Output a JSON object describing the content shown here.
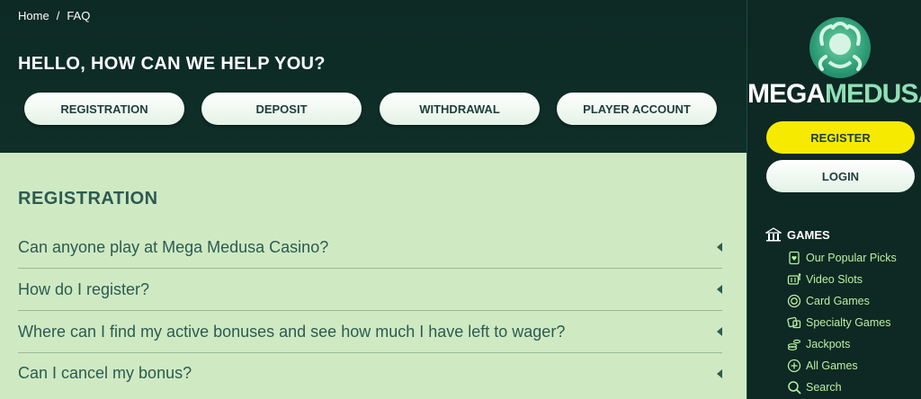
{
  "breadcrumb": {
    "home": "Home",
    "separator": "/",
    "current": "FAQ"
  },
  "hero": {
    "title": "HELLO, HOW CAN WE HELP YOU?",
    "categories": [
      "REGISTRATION",
      "DEPOSIT",
      "WITHDRAWAL",
      "PLAYER ACCOUNT"
    ]
  },
  "faq": {
    "heading": "REGISTRATION",
    "items": [
      "Can anyone play at Mega Medusa Casino?",
      "How do I register?",
      "Where can I find my active bonuses and see how much I have left to wager?",
      "Can I cancel my bonus?"
    ]
  },
  "sidebar": {
    "logo_word1": "MEGA",
    "logo_word2": "MEDUSA",
    "register_label": "REGISTER",
    "login_label": "LOGIN",
    "games_heading": "GAMES",
    "nav": [
      {
        "label": "Our Popular Picks",
        "icon": "card-heart-icon"
      },
      {
        "label": "Video Slots",
        "icon": "slot-machine-icon"
      },
      {
        "label": "Card Games",
        "icon": "chip-icon"
      },
      {
        "label": "Specialty Games",
        "icon": "dice-icon"
      },
      {
        "label": "Jackpots",
        "icon": "coins-icon"
      },
      {
        "label": "All Games",
        "icon": "plus-circle-icon"
      },
      {
        "label": "Search",
        "icon": "search-icon"
      }
    ]
  },
  "colors": {
    "hero_bg": "#0d2a25",
    "faq_bg": "#cfeac2",
    "faq_text": "#2d5a52",
    "register_yellow": "#f6ea00",
    "nav_green": "#b8f0a0"
  }
}
